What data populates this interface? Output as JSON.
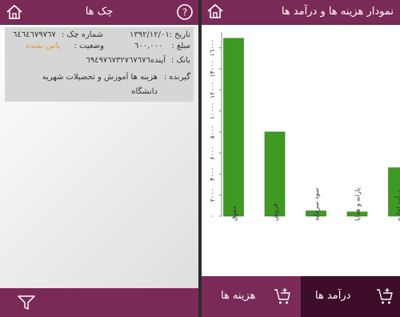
{
  "left": {
    "title": "چک ها",
    "check": {
      "date_label": "تاریخ :",
      "date_value": "۱۳۹۲/۱۲/۰۱",
      "number_label": "شماره چک :",
      "number_value": "٦٤٦٤٦٧٩٧٦٧",
      "amount_label": "مبلغ :",
      "amount_value": "٦۰۰,۰۰۰",
      "status_label": "وضعیت :",
      "status_value": "پاس نشده",
      "bank_label": "بانک :",
      "bank_value": "آینده٦٩٤٩٧٦٧٣٢٧٦٧٦٧٦",
      "receiver_label": "گیرنده :",
      "receiver_value_line1": "هزینه ها  آموزش و تحصیلات  شهریه",
      "receiver_value_line2": "دانشگاه"
    }
  },
  "right": {
    "title": "نمودار هزینه ها و درآمد ها",
    "tabs": [
      {
        "label": "درآمد ها",
        "active": true
      },
      {
        "label": "هزینه ها",
        "active": false
      }
    ]
  },
  "colors": {
    "header": "#7a2a56",
    "active_tab": "#3d0d2a",
    "bar": "#3e9a22",
    "bar_edge": "#2d7516",
    "status_orange": "#e49a3a"
  },
  "icons": {
    "home": "home-icon",
    "help": "help-icon",
    "filter": "filter-icon",
    "cart_add": "cart-add-icon"
  },
  "chart_data": {
    "type": "bar",
    "title": "",
    "xlabel": "",
    "ylabel": "",
    "categories": [
      "حقوق",
      "فروش",
      "سود سرمایه",
      "یارانه و هدایا",
      "درآمد اجاره"
    ],
    "values": [
      16900,
      8000,
      500,
      400,
      4600
    ],
    "ylim": [
      0,
      17500
    ],
    "yticks": [
      0,
      2000,
      4000,
      6000,
      8000,
      10000,
      12000,
      14000,
      16000
    ],
    "ytick_labels": [
      "۰",
      "۲۰۰۰",
      "۴۰۰۰",
      "۶۰۰۰",
      "۸۰۰۰",
      "۱۰۰۰۰",
      "۱۲۰۰۰",
      "۱۴۰۰۰",
      "۱٦۰۰۰"
    ],
    "grid": false,
    "legend": "none"
  }
}
